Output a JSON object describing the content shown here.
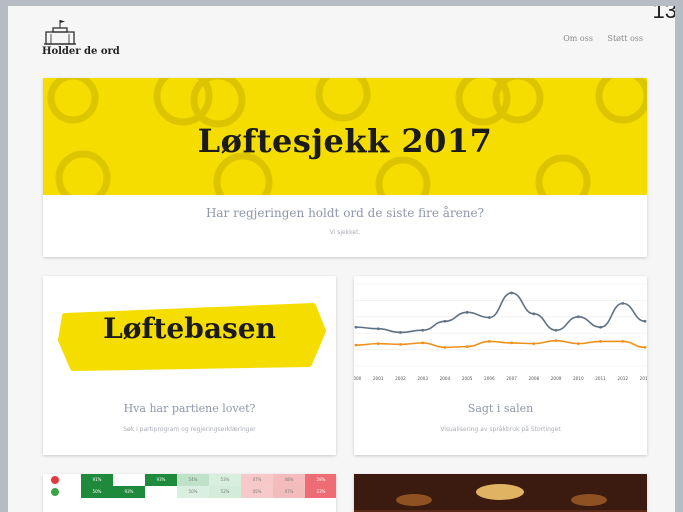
{
  "header": {
    "corner_text": "13",
    "logo_text": "Holder de ord",
    "nav": [
      "Om oss",
      "Støtt oss"
    ]
  },
  "hero": {
    "banner_text": "Løftesjekk 2017",
    "title": "Har regjeringen holdt ord de siste fire årene?",
    "subtitle": "Vi sjekket."
  },
  "cards": [
    {
      "banner_text": "Løftebasen",
      "title": "Hva har partiene lovet?",
      "subtitle": "Søk i partiprogram og regjeringserklæringer"
    },
    {
      "title": "Sagt i salen",
      "subtitle": "Visualisering av språkbruk på Stortinget"
    }
  ],
  "chart_data": {
    "type": "line",
    "x": [
      "2000",
      "2001",
      "2002",
      "2003",
      "2004",
      "2005",
      "2006",
      "2007",
      "2008",
      "2009",
      "2010",
      "2011",
      "2012",
      "2013"
    ],
    "series": [
      {
        "color": "#5f7285",
        "values": [
          52,
          50,
          45,
          48,
          60,
          72,
          65,
          98,
          70,
          48,
          66,
          52,
          84,
          60
        ]
      },
      {
        "color": "#f0901b",
        "values": [
          28,
          30,
          29,
          31,
          25,
          26,
          33,
          31,
          30,
          34,
          30,
          33,
          33,
          25
        ]
      }
    ],
    "ylim": [
      0,
      110
    ],
    "grid": true
  },
  "heatmap": {
    "rows": [
      [
        "91%",
        "",
        "93%",
        "54%",
        "53%",
        "47%",
        "48%",
        "28%"
      ],
      [
        "50%",
        "93%",
        "",
        "50%",
        "52%",
        "45%",
        "47%",
        "23%"
      ]
    ]
  },
  "colors": {
    "accent_yellow": "#f6dd00",
    "text_muted": "#8e97a9"
  }
}
